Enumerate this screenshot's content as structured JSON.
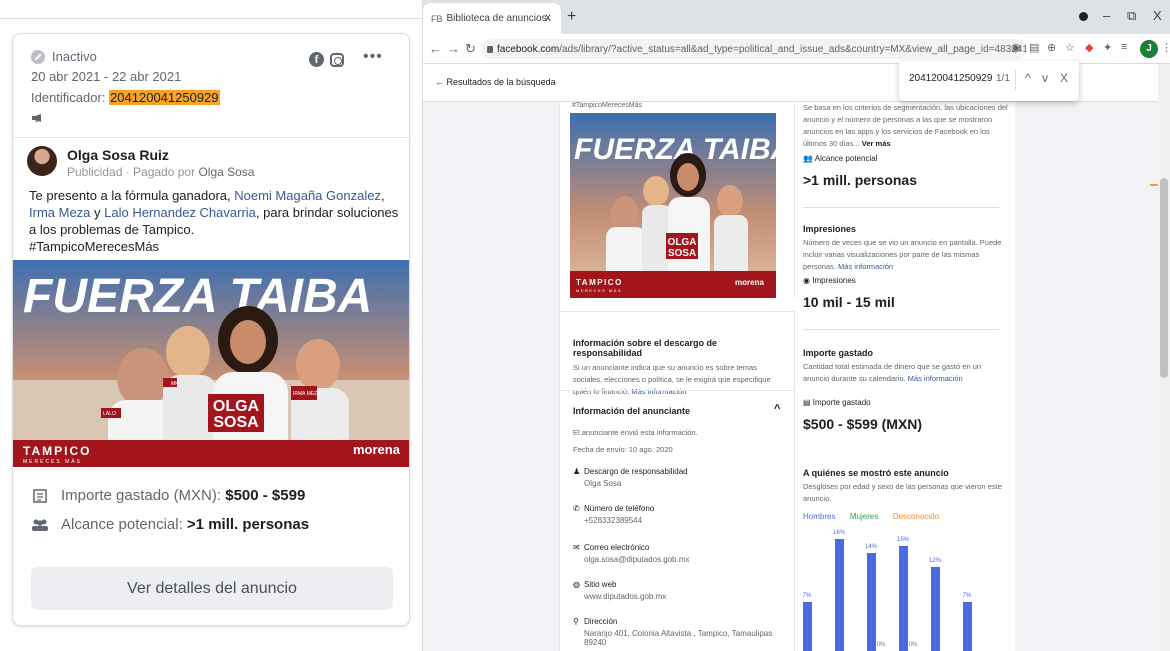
{
  "left_panel": {
    "status": "Inactivo",
    "date_range": "20 abr 2021 - 22 abr 2021",
    "identifier_label": "Identificador:",
    "identifier_value": "204120041250929",
    "advertiser_name": "Olga Sosa Ruiz",
    "sponsored_prefix": "Publicidad · Pagado por",
    "sponsored_by": "Olga Sosa",
    "text_part1": "Te presento a la fórmula ganadora, ",
    "link1": "Noemi Magaña Gonzalez",
    "sep1": ", ",
    "link2": "Irma Meza",
    "text_part2": " y ",
    "link3": "Lalo Hernandez Chavarria",
    "text_part3": ", para brindar soluciones a los problemas de Tampico.",
    "hashtag": "#TampicoMerecesMás",
    "spent_label": "Importe gastado (MXN):",
    "spent_value": "$500 - $599",
    "reach_label": "Alcance potencial:",
    "reach_value": ">1 mill. personas",
    "details_button": "Ver detalles del anuncio"
  },
  "ad_creative": {
    "headline": "FUERZA TAIBA",
    "name_tag_top": "OLGA",
    "name_tag_bottom": "SOSA",
    "city": "TAMPICO",
    "city_sub": "MERECES MÁS",
    "party": "morena",
    "badge1": "MM",
    "badge2": "IRMA MEZA",
    "badge3": "LALO"
  },
  "browser": {
    "tab_title": "Biblioteca de anuncios",
    "tab_favicon": "FB",
    "tab_close": "x",
    "new_tab": "+",
    "minimize": "–",
    "maximize": "⧉",
    "close": "X",
    "url_domain": "facebook.com",
    "url_rest": "/ads/library/?active_status=all&ad_type=political_and_issue_ads&country=MX&view_all_page_id=483241355069273&sort_data[dire...",
    "profile_initial": "J",
    "back_link": "Resultados de la búsqueda",
    "find_query": "204120041250929",
    "find_count": "1/1",
    "find_up": "^",
    "find_down": "v",
    "find_close": "X"
  },
  "detail_col1": {
    "hashtag": "#TampicoMerecesMás",
    "disclaimer_title": "Información sobre el descargo de responsabilidad",
    "disclaimer_body": "Si un anunciante indica que su anuncio es sobre temas sociales, elecciones o política, se le exigirá que especifique quién lo financió.",
    "disclaimer_link": "Más información",
    "advertiser_title": "Información del anunciante",
    "advertiser_sub": "El anunciante envió esta información.",
    "submit_date": "Fecha de envío: 10 ago. 2020",
    "f1_label": "Descargo de responsabilidad",
    "f1_value": "Olga Sosa",
    "f2_label": "Número de teléfono",
    "f2_value": "+528332389544",
    "f3_label": "Correo electrónico",
    "f3_value": "olga.sosa@diputados.gob.mx",
    "f4_label": "Sitio web",
    "f4_value": "www.diputados.gob.mx",
    "f5_label": "Dirección",
    "f5_value": "Naranjo 401, Colonia Altavista , Tampico, Tamaulipas 89240"
  },
  "detail_col2": {
    "reach_body": "Se basa en los criterios de segmentación, las ubicaciones del anuncio y el número de personas a las que se mostraron anuncios en las apps y los servicios de Facebook en los últimos 30 días...",
    "reach_more": "Ver más",
    "reach_label": "Alcance potencial",
    "reach_value": ">1 mill. personas",
    "imp_title": "Impresiones",
    "imp_body": "Número de veces que se vio un anuncio en pantalla. Puede incluir varias visualizaciones por parte de las mismas personas.",
    "imp_link": "Más información",
    "imp_label": "Impresiones",
    "imp_value": "10 mil - 15 mil",
    "spent_title": "Importe gastado",
    "spent_body": "Cantidad total estimada de dinero que se gastó en un anuncio durante su calendario.",
    "spent_link": "Más información",
    "spent_label": "Importe gastado",
    "spent_value": "$500 - $599 (MXN)",
    "who_title": "A quiénes se mostró este anuncio",
    "who_body": "Desgloses por edad y sexo de las personas que vieron este anuncio.",
    "legend_men": "Hombres",
    "legend_women": "Mujeres",
    "legend_unknown": "Desconocido"
  },
  "chart_data": {
    "type": "bar",
    "series": [
      {
        "name": "Hombres",
        "values": [
          7,
          16,
          14,
          15,
          12,
          7
        ]
      }
    ],
    "labels": [
      "7%",
      "16%",
      "14%",
      "15%",
      "12%",
      "7%"
    ],
    "small_labels": [
      "0%",
      "0%"
    ]
  },
  "colors": {
    "identifier_highlight": "#f7a325",
    "link": "#385898",
    "men": "#4a6be0",
    "women": "#31a24c",
    "unknown": "#f7892c",
    "brand_red": "#a3151d"
  }
}
